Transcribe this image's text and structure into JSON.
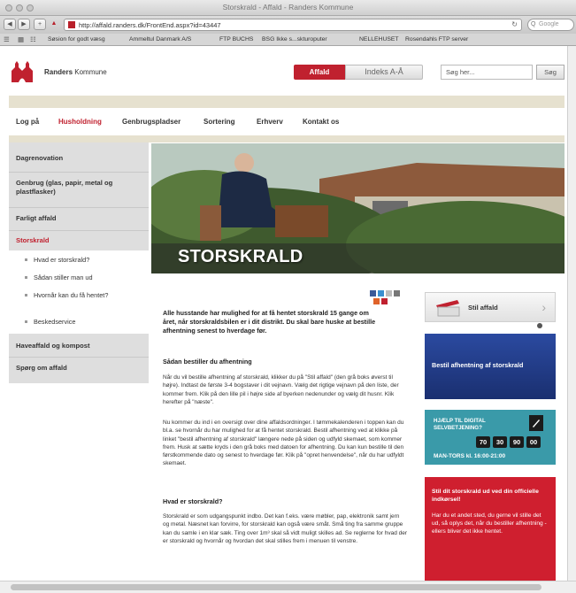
{
  "browser": {
    "window_title": "Storskrald - Affald - Randers Kommune",
    "url": "http://affald.randers.dk/FrontEnd.aspx?id=43447",
    "search_placeholder": "Google",
    "bookmarks": [
      "Søsion for godt væsg",
      "Ammeltul Danmark A/S",
      "FTP BUCHS",
      "BSG Ikke s...skturoputer",
      "NELLEHUSET",
      "Rosendahls FTP server"
    ]
  },
  "header": {
    "brand_bold": "Randers",
    "brand_rest": " Kommune",
    "tab_affald": "Affald",
    "tab_indeks": "Indeks A-Å",
    "search_placeholder": "Søg her...",
    "search_button": "Søg"
  },
  "mainnav": [
    "Log på",
    "Husholdning",
    "Genbrugspladser",
    "Sortering",
    "Erhverv",
    "Kontakt os"
  ],
  "sidebar": {
    "items": [
      "Dagrenovation",
      "Genbrug (glas, papir, metal og plastflasker)",
      "Farligt affald",
      "Storskrald"
    ],
    "sub_items": [
      "Hvad er storskrald?",
      "Sådan stiller man ud",
      "Hvornår kan du få hentet?",
      "Beskedservice"
    ],
    "bottom_items": [
      "Haveaffald og kompost",
      "Spørg om affald"
    ]
  },
  "hero": {
    "title": "STORSKRALD"
  },
  "article": {
    "lead": "Alle husstande har mulighed for at få hentet storskrald 15 gange om året, når storskraldsbilen er i dit distrikt. Du skal bare huske at bestille afhentning senest to hverdage før.",
    "h_bestil": "Sådan bestiller du afhentning",
    "p1": "Når du vil bestille afhentning af storskrald, klikker du på \"Stil affald\" (den grå boks øverst til højre). Indtast de første 3-4 bogstaver i dit vejnavn. Vælg det rigtige vejnavn på den liste, der kommer frem. Klik på den lille pil i højre side af byerken nedenunder og vælg dit husnr. Klik herefter på \"næste\".",
    "p2": "Nu kommer du ind i en oversigt over dine affaldsordninger. I tømmekalenderen i toppen kan du bl.a. se hvornår du har mulighed for at få hentet storskrald. Bestil afhentning ved at klikke på linket \"bestil afhentning af storskrald\" længere nede på siden og udfyld skemaet, som kommer frem. Husk at sætte kryds i den grå boks med datoen for afhentning. Du kan kun bestille til den førstkommende dato og senest to hverdage før. Klik på \"opret henvendelse\", når du har udfyldt skemaet.",
    "h_hvad": "Hvad er storskrald?",
    "p3": "Storskrald er som udgangspunkt indbo. Det kan f.eks. være møbler, pap, elektronik samt jern og metal. Næsnet kan forvirre, for storskrald kan også være småt. Små ting fra samme gruppe kan du samle i en klar sæk. Ting over 1m³ skal så vidt muligt skilles ad. Se reglerne for hvad der er storskrald og hvornår og hvordan det skal stilles frem i menuen til venstre."
  },
  "right": {
    "stil_label": "Stil affald",
    "blue_label": "Bestil afhentning af storskrald",
    "teal_title": "HJÆLP TIL DIGITAL SELVBETJENING?",
    "teal_clock": [
      "70",
      "30",
      "90",
      "00"
    ],
    "teal_phone": "MAN-TORS kl. 16:00-21:00",
    "red_title": "Stil dit storskrald ud ved din officielle indkørsel!",
    "red_body": "Har du et andet sted, du gerne vil stille det ud, så oplys det, når du bestiller afhentning - ellers bliver det ikke hentet."
  }
}
